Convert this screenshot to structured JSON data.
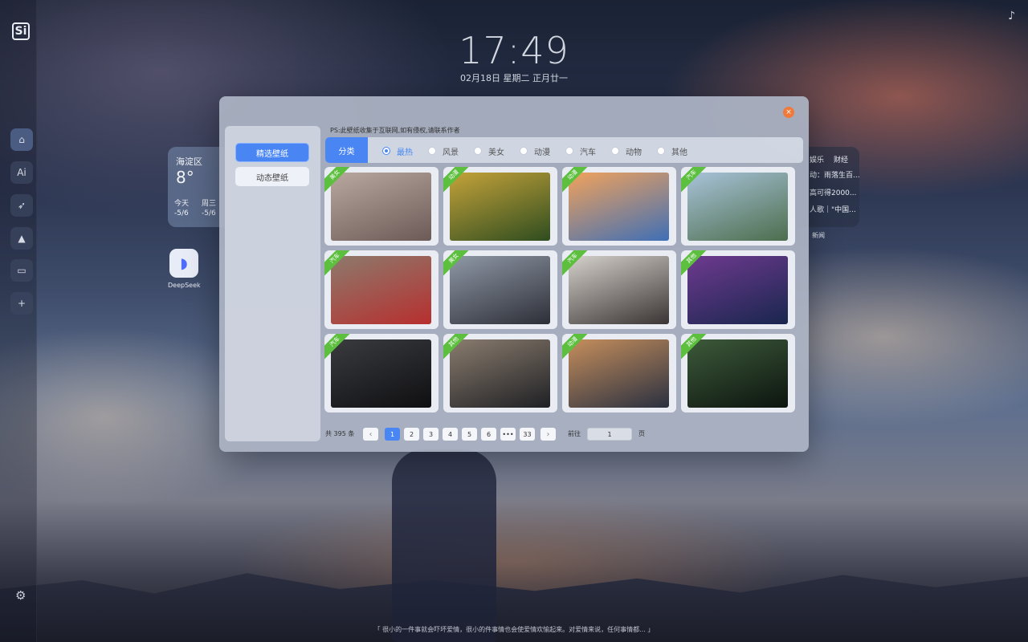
{
  "clock": {
    "time": "17:49",
    "date": "02月18日 星期二 正月廿一"
  },
  "weather": {
    "location": "海淀区",
    "temp": "8°",
    "days": [
      {
        "label": "今天",
        "range": "-5/6"
      },
      {
        "label": "周三",
        "range": "-5/6"
      }
    ]
  },
  "apps": {
    "deepseek_label": "DeepSeek"
  },
  "news": {
    "tabs": [
      "娱乐",
      "财经"
    ],
    "items": [
      "动：雨落生百...",
      "高可得2000...",
      "人歌｜\"中国...",
      "(被覆盖)"
    ],
    "label": "新闻"
  },
  "dock": {
    "logo": "Si",
    "ai_label": "Ai",
    "icons": [
      "home-icon",
      "ai-icon",
      "rocket-icon",
      "graduation-cap-icon",
      "gamepad-icon",
      "add-icon",
      "settings-icon"
    ]
  },
  "quote": "「 很小的一件事就会吓坏爱情，很小的件事情也会使爱情欢愉起来。对爱情来说，任何事情都... 」",
  "wallpaper_modal": {
    "side_tabs": [
      "精选壁纸",
      "动态壁纸"
    ],
    "notice": "PS:此壁纸收集于互联网,如有侵权,请联系作者",
    "category_label": "分类",
    "categories": [
      "最热",
      "风景",
      "美女",
      "动漫",
      "汽车",
      "动物",
      "其他"
    ],
    "selected_category": "最热",
    "cards": [
      {
        "tag": "美女",
        "colors": [
          "#b9a8a0",
          "#6b5a56"
        ]
      },
      {
        "tag": "动漫",
        "colors": [
          "#c4a23a",
          "#2f4d1f"
        ]
      },
      {
        "tag": "动漫",
        "colors": [
          "#f1a25c",
          "#3f6fb5"
        ]
      },
      {
        "tag": "汽车",
        "colors": [
          "#a8c2d8",
          "#4c6e4d"
        ]
      },
      {
        "tag": "汽车",
        "colors": [
          "#8d7a6c",
          "#b72f2f"
        ]
      },
      {
        "tag": "美女",
        "colors": [
          "#8f98a6",
          "#2d2f37"
        ]
      },
      {
        "tag": "汽车",
        "colors": [
          "#d4d0ca",
          "#3a3534"
        ]
      },
      {
        "tag": "其他",
        "colors": [
          "#6e3a8f",
          "#19264e"
        ]
      },
      {
        "tag": "汽车",
        "colors": [
          "#3a3b3f",
          "#0f0f12"
        ]
      },
      {
        "tag": "其他",
        "colors": [
          "#8a7c6e",
          "#1f2024"
        ]
      },
      {
        "tag": "动漫",
        "colors": [
          "#c58e5c",
          "#2a3040"
        ]
      },
      {
        "tag": "其他",
        "colors": [
          "#3d5a3a",
          "#0c140f"
        ]
      }
    ],
    "pagination": {
      "total_text": "共 395 条",
      "pages": [
        "1",
        "2",
        "3",
        "4",
        "5",
        "6",
        "•••",
        "33"
      ],
      "current": "1",
      "prev": "‹",
      "next": "›",
      "goto_label": "前往",
      "goto_value": "1",
      "page_unit": "页"
    },
    "close": "×"
  },
  "colors": {
    "accent": "#4a86f3",
    "ribbon": "#5cbf3e",
    "close": "#f07a3c"
  }
}
